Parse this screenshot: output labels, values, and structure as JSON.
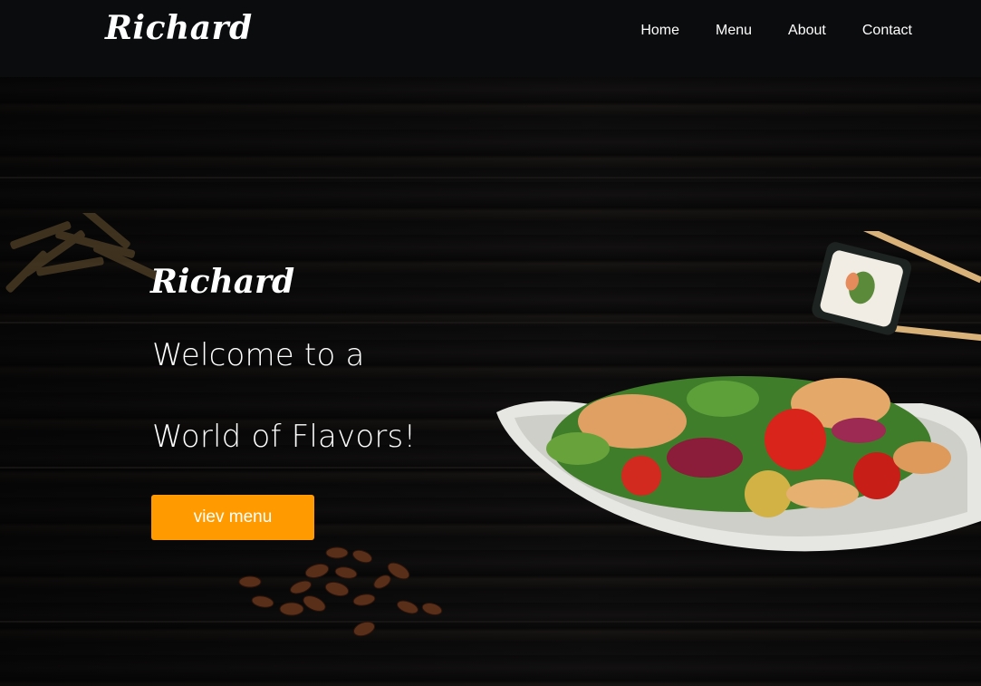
{
  "brand": {
    "logo": "Richard"
  },
  "nav": {
    "items": [
      "Home",
      "Menu",
      "About",
      "Contact"
    ]
  },
  "hero": {
    "logo": "Richard",
    "headline_line1": "Welcome to a",
    "headline_line2": "World of Flavors!",
    "cta_label": "viev menu"
  },
  "colors": {
    "navbar_bg": "#0b0c0e",
    "accent": "#ff9b00",
    "text": "#ffffff"
  }
}
